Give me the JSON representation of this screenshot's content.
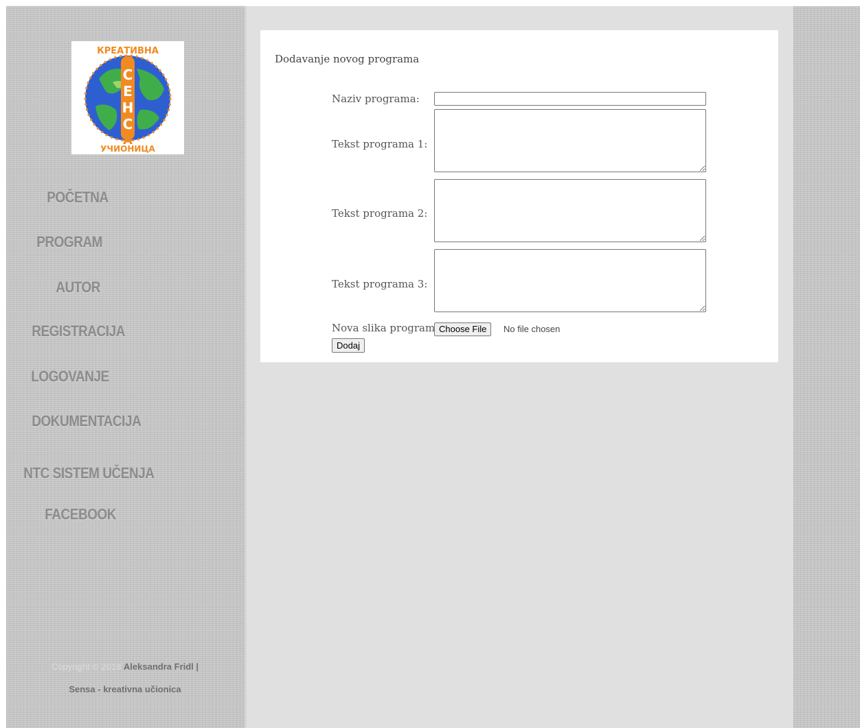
{
  "sidebar": {
    "logo": {
      "top_text": "КРЕАТИВНА",
      "center_text": "СЕНСА",
      "bottom_text": "УЧИОНИЦА",
      "colors": {
        "ocean": "#2e5fd0",
        "land": "#3fae4a",
        "lettering": "#f28a22"
      }
    },
    "nav": [
      {
        "label": "POČETNA"
      },
      {
        "label": "PROGRAM"
      },
      {
        "label": "AUTOR"
      },
      {
        "label": "REGISTRACIJA"
      },
      {
        "label": "LOGOVANJE"
      },
      {
        "label": "DOKUMENTACIJA"
      },
      {
        "label": "NTC SISTEM UČENJA"
      },
      {
        "label": "FACEBOOK"
      }
    ],
    "footer": {
      "copyright": "Copyright © 2018",
      "author": "Aleksandra Fridl |",
      "site": "Sensa - kreativna učionica"
    }
  },
  "form": {
    "title": "Dodavanje novog programa",
    "name_label": "Naziv programa:",
    "name_value": "",
    "text1_label": "Tekst programa 1:",
    "text2_label": "Tekst programa 2:",
    "text3_label": "Tekst programa 3:",
    "image_label": "Nova slika program:",
    "file_button": "Choose File",
    "file_status": "No file chosen",
    "submit_label": "Dodaj"
  },
  "colors": {
    "background": "#e0e0e0",
    "sidebar": "#c3c3c3",
    "nav_text": "#8c8c8c",
    "panel": "#ffffff"
  }
}
